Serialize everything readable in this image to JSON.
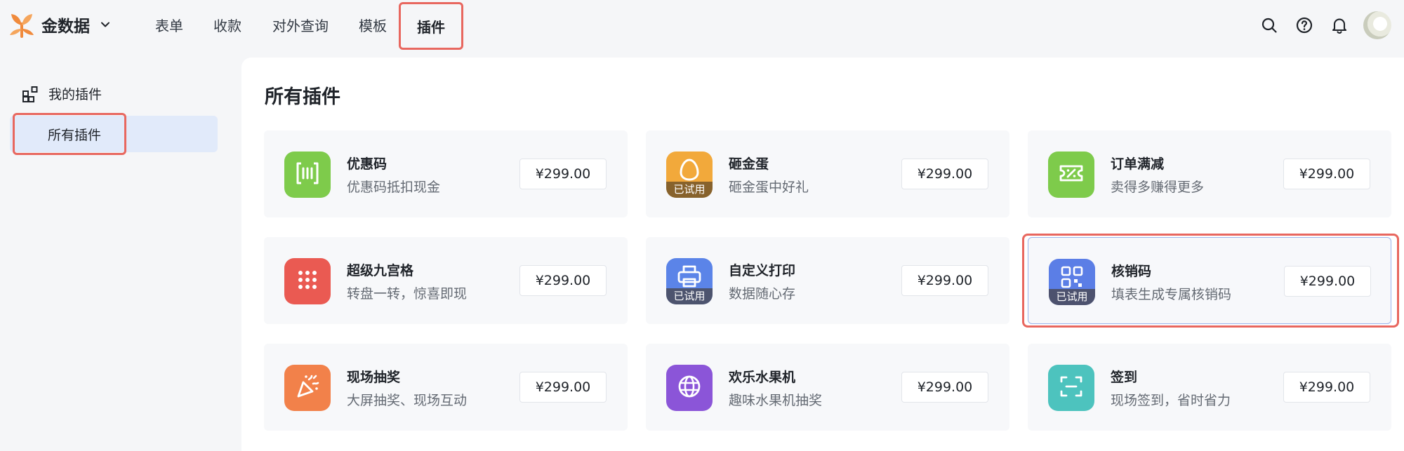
{
  "header": {
    "brand_name": "金数据",
    "nav_tabs": [
      {
        "label": "表单"
      },
      {
        "label": "收款"
      },
      {
        "label": "对外查询"
      },
      {
        "label": "模板"
      },
      {
        "label": "插件",
        "active": true
      }
    ],
    "icons": [
      "search-icon",
      "help-icon",
      "bell-icon",
      "avatar"
    ]
  },
  "sidebar": {
    "section_label": "我的插件",
    "active_item_label": "所有插件"
  },
  "main": {
    "title": "所有插件",
    "plugins": [
      {
        "name": "优惠码",
        "desc": "优惠码抵扣现金",
        "price": "¥299.00",
        "icon": "coupon-scan-icon",
        "color": "#7ecb4b",
        "trial": ""
      },
      {
        "name": "砸金蛋",
        "desc": "砸金蛋中好礼",
        "price": "¥299.00",
        "icon": "egg-icon",
        "color": "#f2a93b",
        "trial": "已试用"
      },
      {
        "name": "订单满减",
        "desc": "卖得多赚得更多",
        "price": "¥299.00",
        "icon": "ticket-icon",
        "color": "#7ecb4b",
        "trial": ""
      },
      {
        "name": "超级九宫格",
        "desc": "转盘一转，惊喜即现",
        "price": "¥299.00",
        "icon": "grid-dots-icon",
        "color": "#ea5a52",
        "trial": ""
      },
      {
        "name": "自定义打印",
        "desc": "数据随心存",
        "price": "¥299.00",
        "icon": "printer-icon",
        "color": "#5b84e8",
        "trial": "已试用"
      },
      {
        "name": "核销码",
        "desc": "填表生成专属核销码",
        "price": "¥299.00",
        "icon": "qr-code-icon",
        "color": "#5b7ee6",
        "trial": "已试用"
      },
      {
        "name": "现场抽奖",
        "desc": "大屏抽奖、现场互动",
        "price": "¥299.00",
        "icon": "party-popper-icon",
        "color": "#f2814a",
        "trial": ""
      },
      {
        "name": "欢乐水果机",
        "desc": "趣味水果机抽奖",
        "price": "¥299.00",
        "icon": "globe-icon",
        "color": "#8b55d8",
        "trial": ""
      },
      {
        "name": "签到",
        "desc": "现场签到，省时省力",
        "price": "¥299.00",
        "icon": "scan-frame-icon",
        "color": "#4dc3be",
        "trial": ""
      }
    ]
  }
}
